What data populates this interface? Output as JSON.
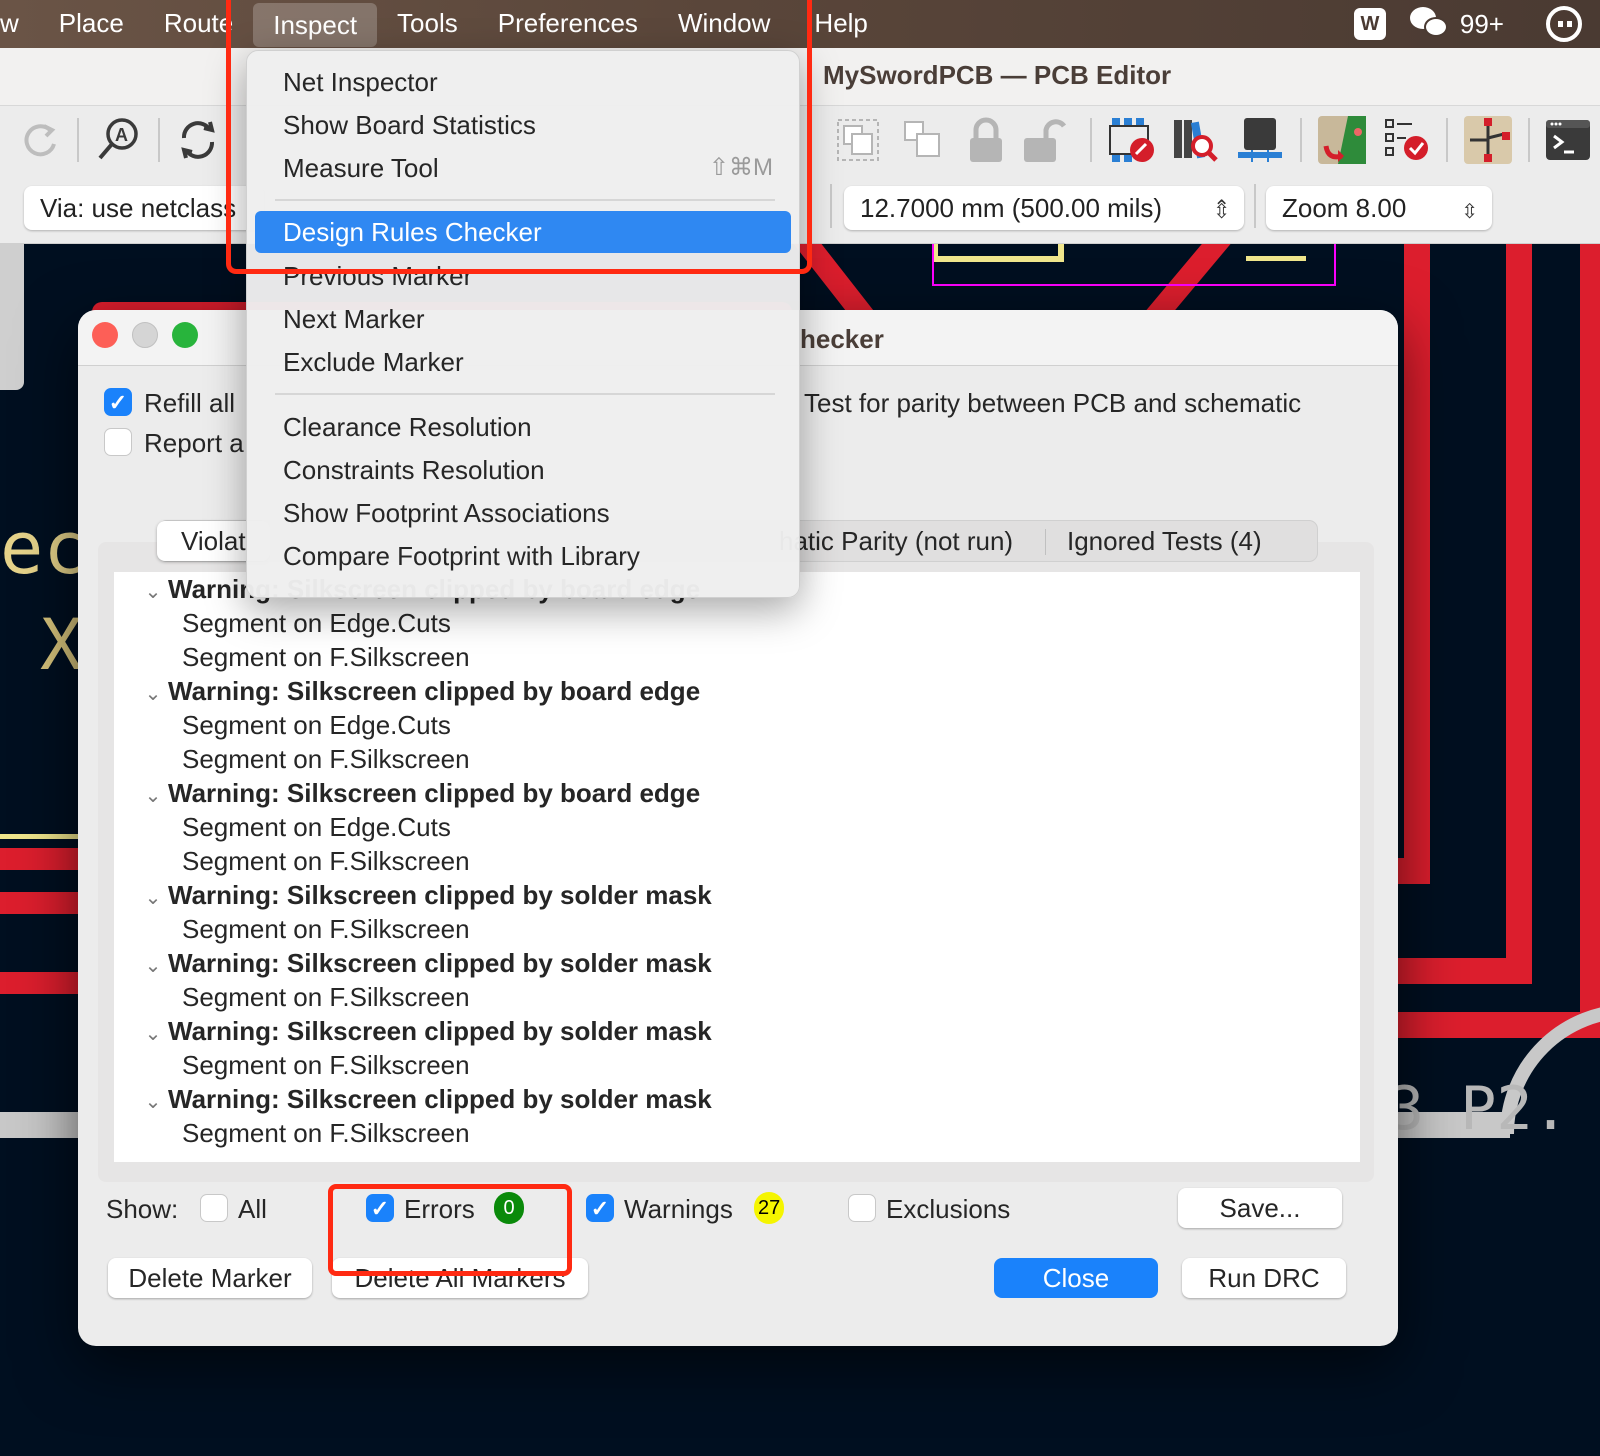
{
  "menubar": {
    "items": [
      {
        "label": "w"
      },
      {
        "label": "Place"
      },
      {
        "label": "Route"
      },
      {
        "label": "Inspect",
        "active": true
      },
      {
        "label": "Tools"
      },
      {
        "label": "Preferences"
      },
      {
        "label": "Window"
      },
      {
        "label": "Help"
      }
    ],
    "status": {
      "wps_icon": "wps-icon",
      "wechat_icon": "wechat-icon",
      "wechat_badge": "99+",
      "face_icon": "face-icon"
    }
  },
  "window": {
    "title": "MySwordPCB — PCB Editor"
  },
  "toolbar": {
    "icons": [
      "redo-icon",
      "find-icon",
      "refresh-icon",
      "group-icon",
      "ungroup-icon",
      "lock-icon",
      "unlock-icon",
      "footprint-editor-icon",
      "library-browser-icon",
      "3d-viewer-icon",
      "update-pcb-icon",
      "drc-icon",
      "schematic-icon",
      "scripting-console-icon"
    ],
    "via_select": "Via: use netclass",
    "grid_select": "12.7000 mm (500.00 mils)",
    "zoom_select": "Zoom 8.00"
  },
  "inspect_menu": {
    "items": [
      {
        "label": "Net Inspector"
      },
      {
        "label": "Show Board Statistics"
      },
      {
        "label": "Measure Tool",
        "shortcut": "⇧⌘M"
      },
      {
        "label": "Design Rules Checker",
        "highlighted": true
      },
      {
        "label": "Previous Marker"
      },
      {
        "label": "Next Marker"
      },
      {
        "label": "Exclude Marker"
      },
      {
        "label": "Clearance Resolution"
      },
      {
        "label": "Constraints Resolution"
      },
      {
        "label": "Show Footprint Associations"
      },
      {
        "label": "Compare Footprint with Library"
      }
    ]
  },
  "drc_dialog": {
    "title_visible": "hecker",
    "options": {
      "refill_all": {
        "label": "Refill all",
        "checked": true
      },
      "report_all": {
        "label": "Report a",
        "checked": false
      },
      "parity": {
        "label": "Test for parity between PCB and schematic"
      }
    },
    "tabs": [
      {
        "label": "Violat",
        "selected": true
      },
      {
        "label": "hatic Parity (not run)"
      },
      {
        "label": "Ignored Tests (4)"
      }
    ],
    "violations": [
      {
        "title": "Warning: Silkscreen clipped by board edge",
        "items": [
          "Segment on Edge.Cuts",
          "Segment on F.Silkscreen"
        ]
      },
      {
        "title": "Warning: Silkscreen clipped by board edge",
        "items": [
          "Segment on Edge.Cuts",
          "Segment on F.Silkscreen"
        ]
      },
      {
        "title": "Warning: Silkscreen clipped by board edge",
        "items": [
          "Segment on Edge.Cuts",
          "Segment on F.Silkscreen"
        ]
      },
      {
        "title": "Warning: Silkscreen clipped by solder mask",
        "items": [
          "Segment on F.Silkscreen"
        ]
      },
      {
        "title": "Warning: Silkscreen clipped by solder mask",
        "items": [
          "Segment on F.Silkscreen"
        ]
      },
      {
        "title": "Warning: Silkscreen clipped by solder mask",
        "items": [
          "Segment on F.Silkscreen"
        ]
      },
      {
        "title": "Warning: Silkscreen clipped by solder mask",
        "items": [
          "Segment on F.Silkscreen"
        ]
      }
    ],
    "show": {
      "label": "Show:",
      "all": {
        "label": "All",
        "checked": false
      },
      "errors": {
        "label": "Errors",
        "checked": true,
        "count": "0",
        "color": "#0a8a0a"
      },
      "warnings": {
        "label": "Warnings",
        "checked": true,
        "count": "27",
        "color": "#f5f500"
      },
      "exclusions": {
        "label": "Exclusions",
        "checked": false
      }
    },
    "buttons": {
      "save": "Save...",
      "delete_marker": "Delete Marker",
      "delete_all_markers": "Delete All Markers",
      "close": "Close",
      "run_drc": "Run DRC"
    }
  },
  "canvas": {
    "silk_text_1": "ec",
    "silk_text_2": "X",
    "silk_text_3": "3  P2."
  },
  "colors": {
    "accent": "#1a82fb",
    "menu_highlight": "#2f88f2",
    "annotation": "#ff2a12",
    "trace": "#dc1e2d",
    "board_bg": "#000f20"
  }
}
